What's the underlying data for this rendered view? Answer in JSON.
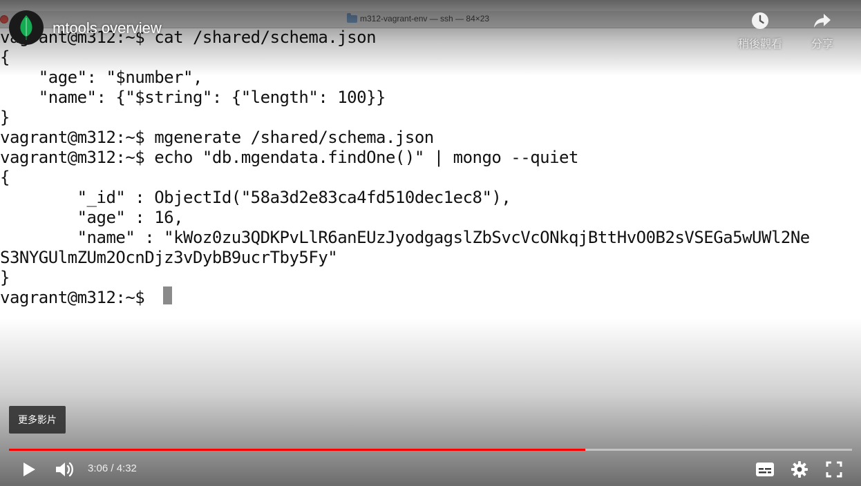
{
  "terminal_window": {
    "title": "m312-vagrant-env — ssh — 84×23",
    "lines": [
      "vagrant@m312:~$ cat /shared/schema.json",
      "{",
      "    \"age\": \"$number\",",
      "    \"name\": {\"$string\": {\"length\": 100}}",
      "}",
      "vagrant@m312:~$ mgenerate /shared/schema.json",
      "vagrant@m312:~$ echo \"db.mgendata.findOne()\" | mongo --quiet",
      "{",
      "        \"_id\" : ObjectId(\"58a3d2e83ca4fd510dec1ec8\"),",
      "        \"age\" : 16,",
      "        \"name\" : \"kWoz0zu3QDKPvLlR6anEUzJyodgagslZbSvcVcONkqjBttHvO0B2sVSEGa5wUWl2Ne",
      "S3NYGUlmZUm2OcnDjz3vDybB9ucrTby5Fy\"",
      "}",
      "vagrant@m312:~$ "
    ]
  },
  "video": {
    "title": "mtools overview",
    "watch_later_label": "稍後觀看",
    "share_label": "分享",
    "more_videos_label": "更多影片",
    "current_time": "3:06",
    "duration": "4:32",
    "time_display": "3:06 / 4:32",
    "progress_fraction": 0.684
  },
  "icons": {
    "avatar": "mongodb-leaf-icon",
    "watch_later": "clock-icon",
    "share": "share-arrow-icon",
    "play": "play-icon",
    "volume": "volume-icon",
    "subtitles": "subtitles-icon",
    "settings": "gear-icon",
    "fullscreen": "fullscreen-icon"
  },
  "colors": {
    "progress_played": "#ff0000",
    "leaf": "#13aa52",
    "close_light": "#ee5c54"
  }
}
